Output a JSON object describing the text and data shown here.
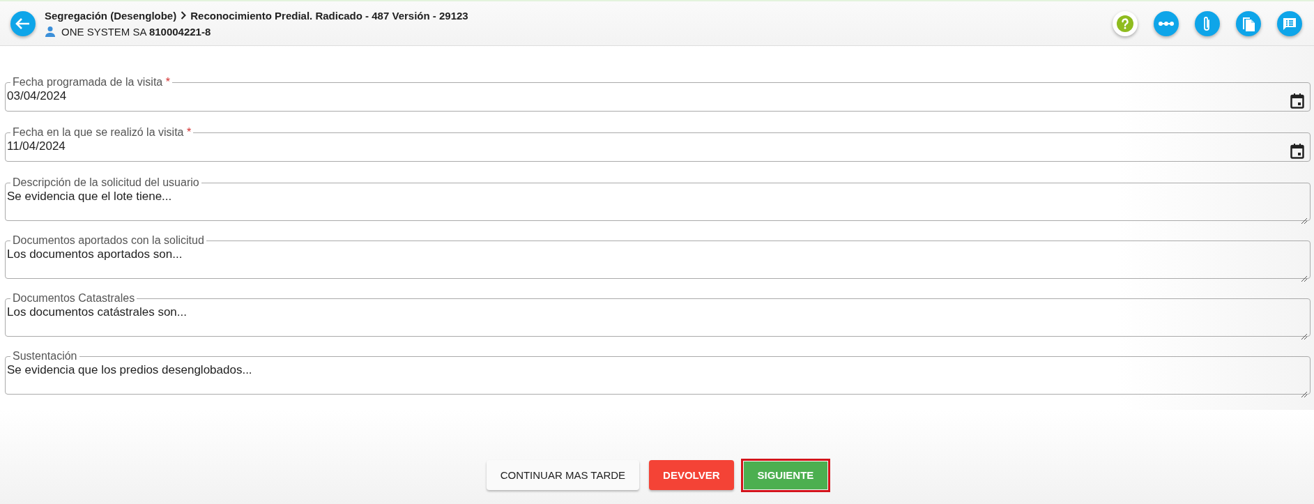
{
  "header": {
    "breadcrumb": [
      "Segregación (Desenglobe)",
      "Reconocimiento Predial. Radicado - 487 Versión - 29123"
    ],
    "company": "ONE SYSTEM SA **810004221-8**",
    "actions": [
      {
        "kind": "help"
      },
      {
        "kind": "flow"
      },
      {
        "kind": "attach"
      },
      {
        "kind": "copy"
      },
      {
        "kind": "notes"
      }
    ]
  },
  "fields": [
    {
      "kind": "date",
      "label": "Fecha programada de la visita",
      "required_mark": "*",
      "value": "03/04/2024"
    },
    {
      "kind": "date",
      "label": "Fecha en la que se realizó la visita",
      "required_mark": "*",
      "value": "11/04/2024"
    },
    {
      "kind": "textarea",
      "label": "Descripción de la solicitud del usuario",
      "value": "Se evidencia que el lote tiene..."
    },
    {
      "kind": "textarea",
      "label": "Documentos aportados con la solicitud",
      "value": "Los documentos aportados son..."
    },
    {
      "kind": "textarea",
      "label": "Documentos Catastrales",
      "value": "Los documentos catástrales son..."
    },
    {
      "kind": "textarea",
      "label": "Sustentación",
      "value": "Se evidencia que los predios desenglobados..."
    }
  ],
  "buttons": [
    {
      "kind": "plain",
      "label": "CONTINUAR MAS TARDE",
      "highlighted": false
    },
    {
      "kind": "danger",
      "label": "DEVOLVER",
      "highlighted": false
    },
    {
      "kind": "success",
      "label": "SIGUIENTE",
      "highlighted": true
    }
  ]
}
